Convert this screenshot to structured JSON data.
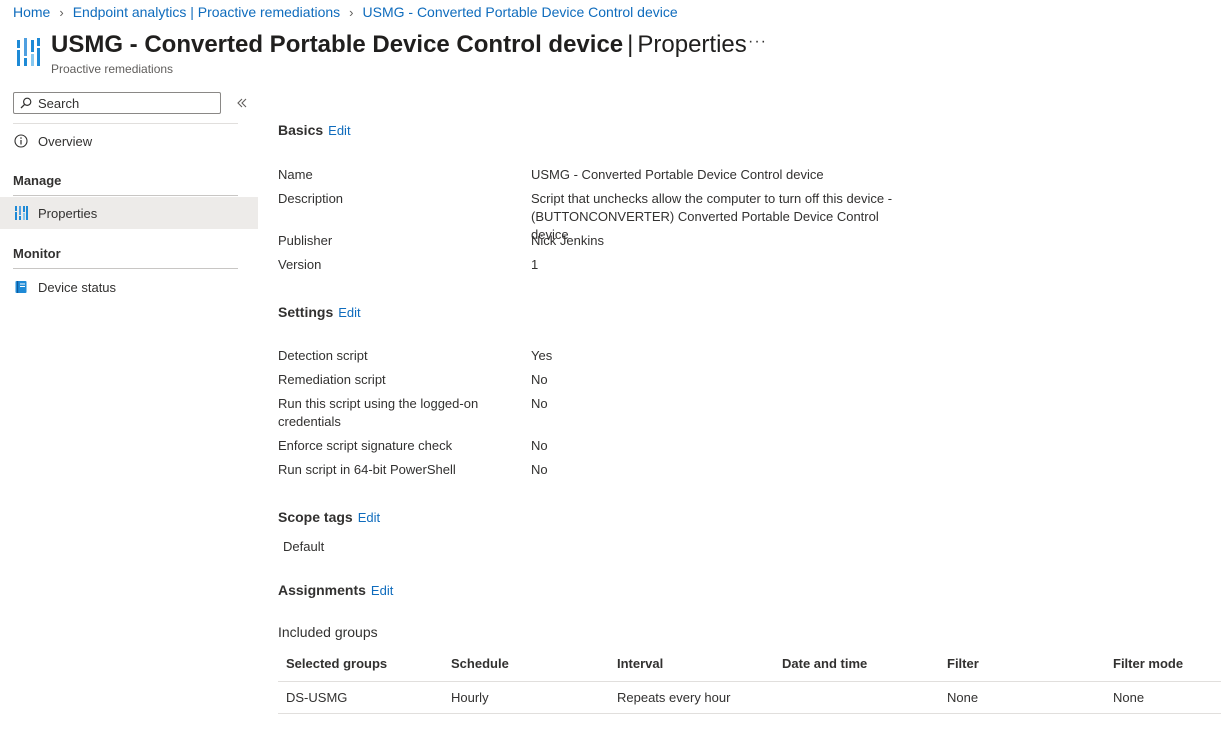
{
  "breadcrumb": {
    "items": [
      "Home",
      "Endpoint analytics | Proactive remediations",
      "USMG - Converted Portable Device Control device"
    ]
  },
  "header": {
    "title": "USMG - Converted Portable Device Control device",
    "separator": "|",
    "title_suffix": "Properties",
    "more": "···",
    "subtitle": "Proactive remediations"
  },
  "sidebar": {
    "search_placeholder": "Search",
    "overview": "Overview",
    "manage_heading": "Manage",
    "properties": "Properties",
    "monitor_heading": "Monitor",
    "device_status": "Device status"
  },
  "basics": {
    "title": "Basics",
    "edit": "Edit",
    "fields": [
      {
        "label": "Name",
        "value": "USMG - Converted Portable Device Control device"
      },
      {
        "label": "Description",
        "value": "Script that unchecks allow the computer to turn off this device - (BUTTONCONVERTER) Converted Portable Device Control device"
      },
      {
        "label": "Publisher",
        "value": "Nick Jenkins"
      },
      {
        "label": "Version",
        "value": "1"
      }
    ]
  },
  "settings": {
    "title": "Settings",
    "edit": "Edit",
    "fields": [
      {
        "label": "Detection script",
        "value": "Yes"
      },
      {
        "label": "Remediation script",
        "value": "No"
      },
      {
        "label": "Run this script using the logged-on credentials",
        "value": "No"
      },
      {
        "label": "Enforce script signature check",
        "value": "No"
      },
      {
        "label": "Run script in 64-bit PowerShell",
        "value": "No"
      }
    ]
  },
  "scope_tags": {
    "title": "Scope tags",
    "edit": "Edit",
    "value": "Default"
  },
  "assignments": {
    "title": "Assignments",
    "edit": "Edit",
    "included_label": "Included groups",
    "columns": [
      "Selected groups",
      "Schedule",
      "Interval",
      "Date and time",
      "Filter",
      "Filter mode"
    ],
    "rows": [
      [
        "DS-USMG",
        "Hourly",
        "Repeats every hour",
        "",
        "None",
        "None"
      ]
    ]
  },
  "colors": {
    "link": "#0f6cbd",
    "selected_bg": "#edebe9",
    "text": "#323130"
  }
}
